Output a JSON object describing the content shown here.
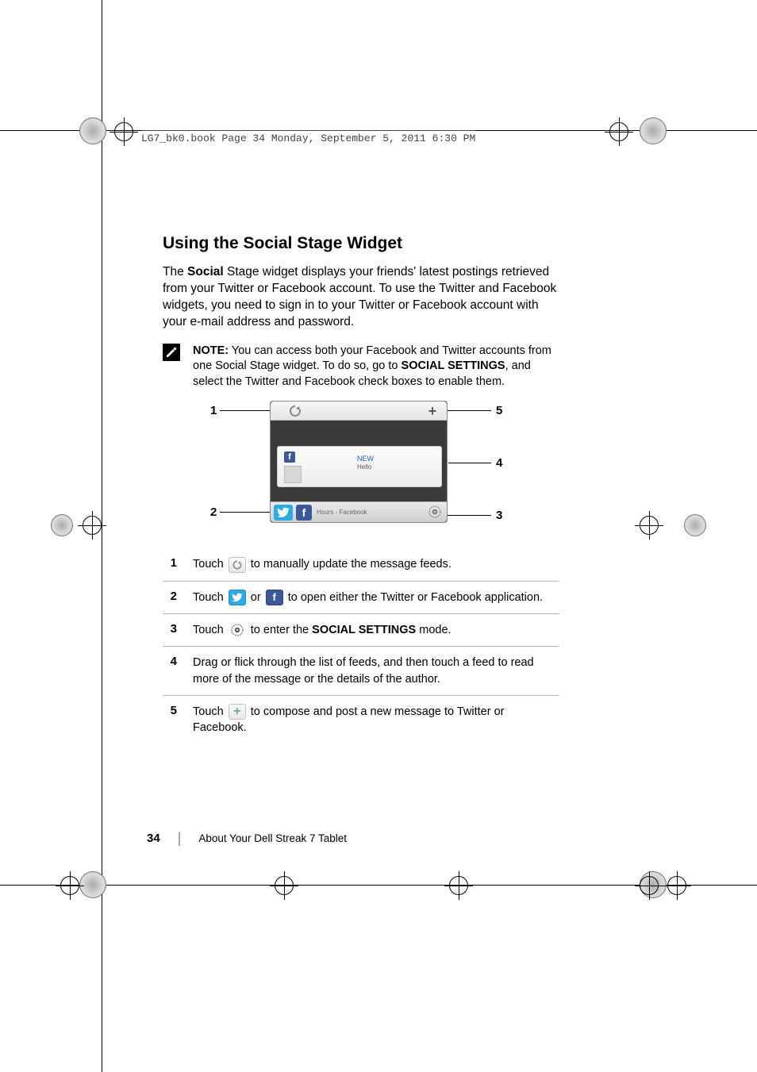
{
  "header_stamp": "LG7_bk0.book  Page 34  Monday, September 5, 2011  6:30 PM",
  "heading": "Using the Social Stage Widget",
  "intro_before_bold": "The ",
  "intro_bold": "Social",
  "intro_after_bold": " Stage widget displays your friends' latest postings retrieved from your Twitter or Facebook account. To use the Twitter and Facebook widgets, you need to sign in to your Twitter or Facebook account with your e-mail address and password.",
  "note_label": "NOTE:",
  "note_body_before": " You can access both your Facebook and Twitter accounts from one Social Stage widget. To do so, go to ",
  "note_bold": "SOCIAL SETTINGS",
  "note_body_after": ", and select the Twitter and Facebook check boxes to enable them.",
  "callouts": {
    "c1": "1",
    "c2": "2",
    "c3": "3",
    "c4": "4",
    "c5": "5"
  },
  "widget": {
    "feed_new": "NEW",
    "feed_hello": "Hello",
    "bottom_label": "Hours - Facebook",
    "fb_letter": "f"
  },
  "steps": [
    {
      "num": "1",
      "pre": "Touch ",
      "post": " to manually update the message feeds."
    },
    {
      "num": "2",
      "pre": "Touch ",
      "mid": " or ",
      "post": " to open either the Twitter or Facebook application."
    },
    {
      "num": "3",
      "pre": "Touch ",
      "mid_bold": "SOCIAL SETTINGS",
      "post_before": " to enter the ",
      "post_after": " mode."
    },
    {
      "num": "4",
      "text": "Drag or flick through the list of feeds, and then touch a feed to read more of the message or the details of the author."
    },
    {
      "num": "5",
      "pre": "Touch ",
      "post": " to compose and post a new message to Twitter or Facebook."
    }
  ],
  "footer": {
    "page": "34",
    "chapter": "About Your Dell Streak 7 Tablet"
  }
}
